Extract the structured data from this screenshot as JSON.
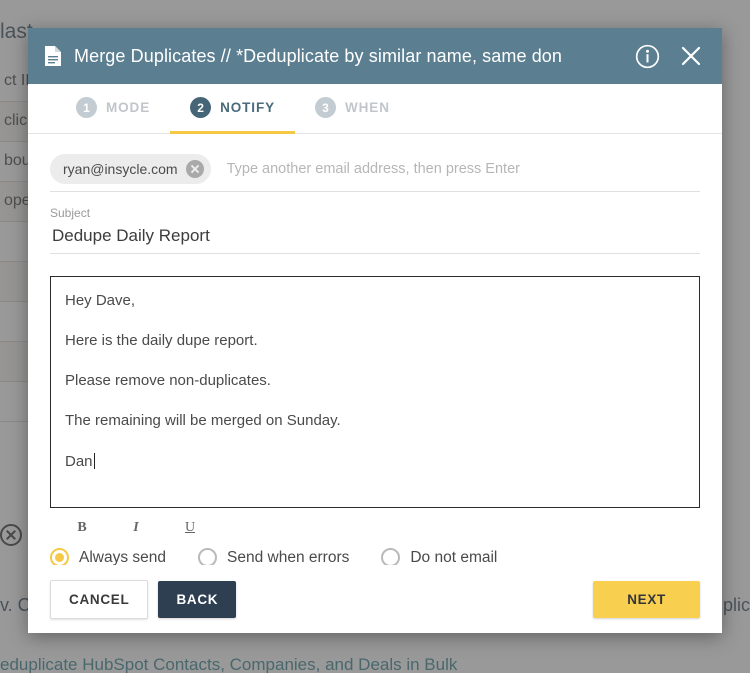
{
  "background": {
    "top_text": "last",
    "rows": [
      {
        "text": "ct ID"
      },
      {
        "text": "clic"
      },
      {
        "text": "bou"
      },
      {
        "text": "ope"
      },
      {
        "text": ""
      },
      {
        "text": ""
      },
      {
        "text": ""
      },
      {
        "text": ""
      },
      {
        "text": ""
      }
    ],
    "remove_row_text": "c",
    "caption": "v. Cl",
    "right_text": "uplic",
    "link": "eduplicate HubSpot Contacts, Companies, and Deals in Bulk"
  },
  "modal": {
    "title": "Merge Duplicates // *Deduplicate by similar name, same don",
    "doc_icon": "document-icon",
    "info_icon": "info-icon",
    "close_icon": "close-icon",
    "header_color": "#5b7f91",
    "tabs": [
      {
        "number": "1",
        "label": "MODE",
        "active": false
      },
      {
        "number": "2",
        "label": "NOTIFY",
        "active": true
      },
      {
        "number": "3",
        "label": "WHEN",
        "active": false
      }
    ],
    "recipients": {
      "chips": [
        {
          "email": "ryan@insycle.com"
        }
      ],
      "placeholder": "Type another email address, then press Enter",
      "input_value": ""
    },
    "subject": {
      "label": "Subject",
      "value": "Dedupe Daily Report"
    },
    "body": {
      "lines": [
        "Hey Dave,",
        "Here is the daily dupe report.",
        "Please remove non-duplicates.",
        "The remaining will be merged on Sunday.",
        "Dan"
      ]
    },
    "format_toolbar": [
      {
        "name": "bold",
        "label": "B"
      },
      {
        "name": "italic",
        "label": "I"
      },
      {
        "name": "underline",
        "label": "U"
      }
    ],
    "send_options": [
      {
        "label": "Always send",
        "selected": true
      },
      {
        "label": "Send when errors",
        "selected": false
      },
      {
        "label": "Do not email",
        "selected": false
      }
    ],
    "footer": {
      "cancel_label": "CANCEL",
      "back_label": "BACK",
      "next_label": "NEXT"
    },
    "accent_yellow": "#f9cf50",
    "dark_navy": "#2e3f52"
  }
}
